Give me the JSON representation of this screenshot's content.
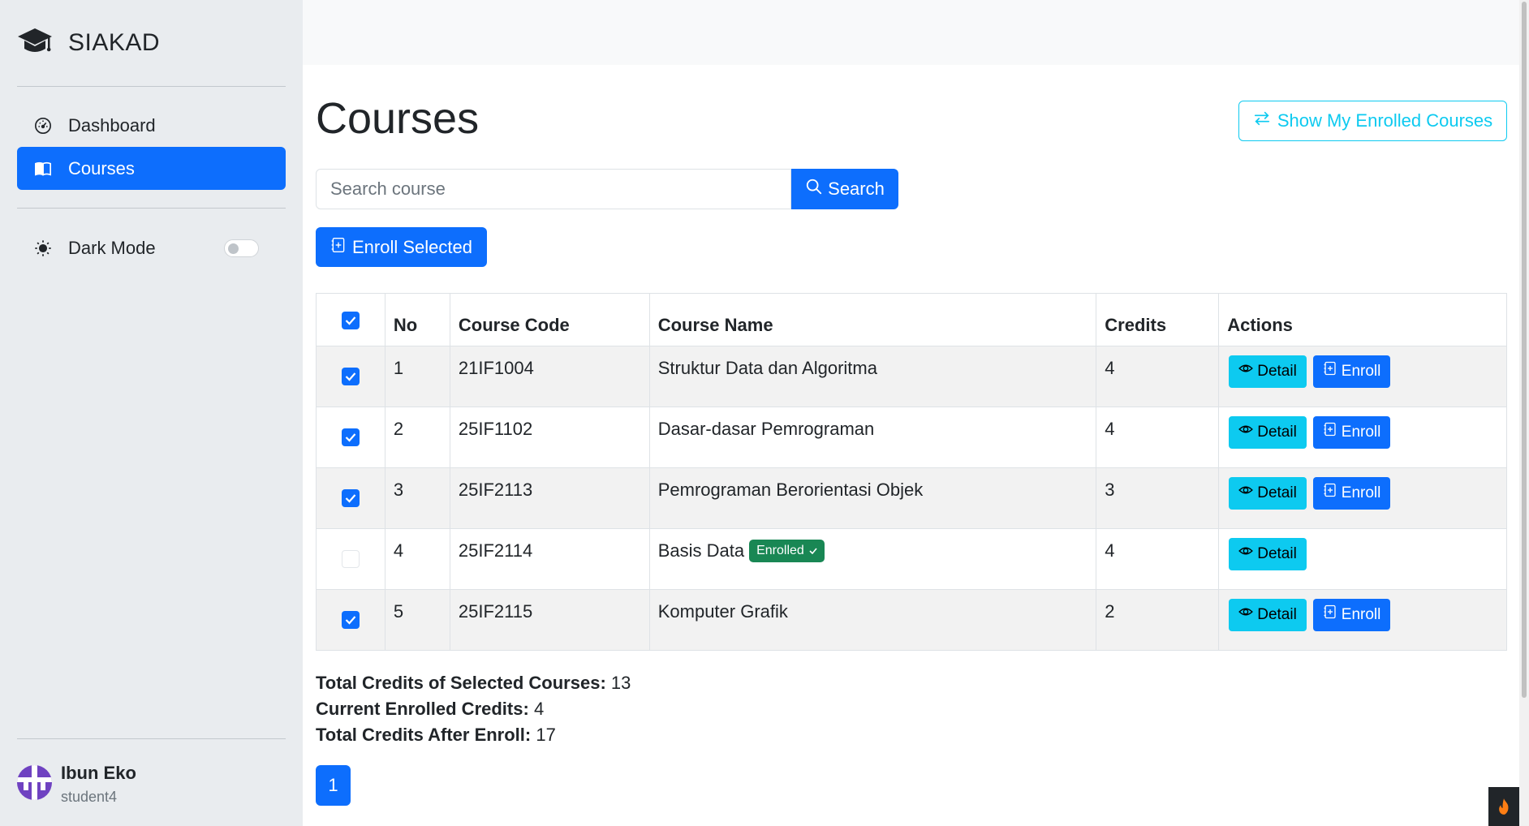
{
  "app": {
    "title": "SIAKAD"
  },
  "sidebar": {
    "items": [
      {
        "label": "Dashboard",
        "icon": "speedometer-icon"
      },
      {
        "label": "Courses",
        "icon": "book-icon",
        "active": true
      }
    ],
    "dark_mode": {
      "label": "Dark Mode",
      "icon": "sun-icon",
      "enabled": false
    }
  },
  "user": {
    "name": "Ibun Eko",
    "role": "student4"
  },
  "page": {
    "title": "Courses",
    "show_enrolled_label": "Show My Enrolled Courses"
  },
  "search": {
    "placeholder": "Search course",
    "value": "",
    "button_label": "Search"
  },
  "enroll_selected_label": "Enroll Selected",
  "table": {
    "header_checked": true,
    "columns": [
      "No",
      "Course Code",
      "Course Name",
      "Credits",
      "Actions"
    ],
    "rows": [
      {
        "checked": true,
        "no": "1",
        "code": "21IF1004",
        "name": "Struktur Data dan Algoritma",
        "credits": "4",
        "enrolled": false
      },
      {
        "checked": true,
        "no": "2",
        "code": "25IF1102",
        "name": "Dasar-dasar Pemrograman",
        "credits": "4",
        "enrolled": false
      },
      {
        "checked": true,
        "no": "3",
        "code": "25IF2113",
        "name": "Pemrograman Berorientasi Objek",
        "credits": "3",
        "enrolled": false
      },
      {
        "checked": false,
        "no": "4",
        "code": "25IF2114",
        "name": "Basis Data",
        "credits": "4",
        "enrolled": true
      },
      {
        "checked": true,
        "no": "5",
        "code": "25IF2115",
        "name": "Komputer Grafik",
        "credits": "2",
        "enrolled": false
      }
    ],
    "detail_label": "Detail",
    "enroll_label": "Enroll",
    "enrolled_badge": "Enrolled"
  },
  "totals": {
    "selected_label": "Total Credits of Selected Courses:",
    "selected_value": "13",
    "current_label": "Current Enrolled Credits:",
    "current_value": "4",
    "after_label": "Total Credits After Enroll:",
    "after_value": "17"
  },
  "pagination": {
    "current": "1"
  },
  "colors": {
    "primary": "#0d6efd",
    "info": "#0dcaf0",
    "success": "#198754",
    "sidebar_bg": "#e9ecef"
  }
}
